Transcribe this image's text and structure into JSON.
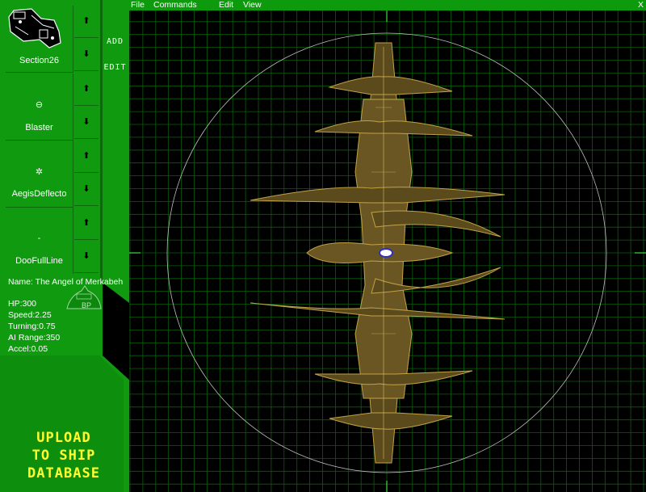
{
  "menu": {
    "file": "File",
    "commands": "Commands",
    "edit": "Edit",
    "view": "View",
    "close": "X"
  },
  "sidebar": {
    "components": [
      {
        "label": "Section26",
        "icon": "section-part-icon"
      },
      {
        "label": "Blaster",
        "icon": "blaster-icon",
        "glyph": "⊖"
      },
      {
        "label": "AegisDeflecto",
        "icon": "aegis-deflector-icon",
        "glyph": "✲"
      },
      {
        "label": "DooFullLine",
        "icon": "line-icon",
        "glyph": "-"
      }
    ],
    "add_label": "ADD",
    "edit_label": "EDIT",
    "arrow_up": "⬆",
    "arrow_down": "⬇"
  },
  "ship": {
    "name_line": "Name: The Angel of Merkabeh",
    "badge": "BP",
    "hp": "HP:300",
    "speed": "Speed:2.25",
    "turning": "Turning:0.75",
    "ai_range": "AI Range:350",
    "accel": "Accel:0.05"
  },
  "upload": {
    "line1": "UPLOAD",
    "line2": "TO SHIP",
    "line3": "DATABASE"
  },
  "colors": {
    "panel": "#0f9a0f",
    "dark": "#0a6a0a",
    "grid": "#0b5e0b",
    "ship": "#b09038",
    "upload": "#ffff30"
  }
}
